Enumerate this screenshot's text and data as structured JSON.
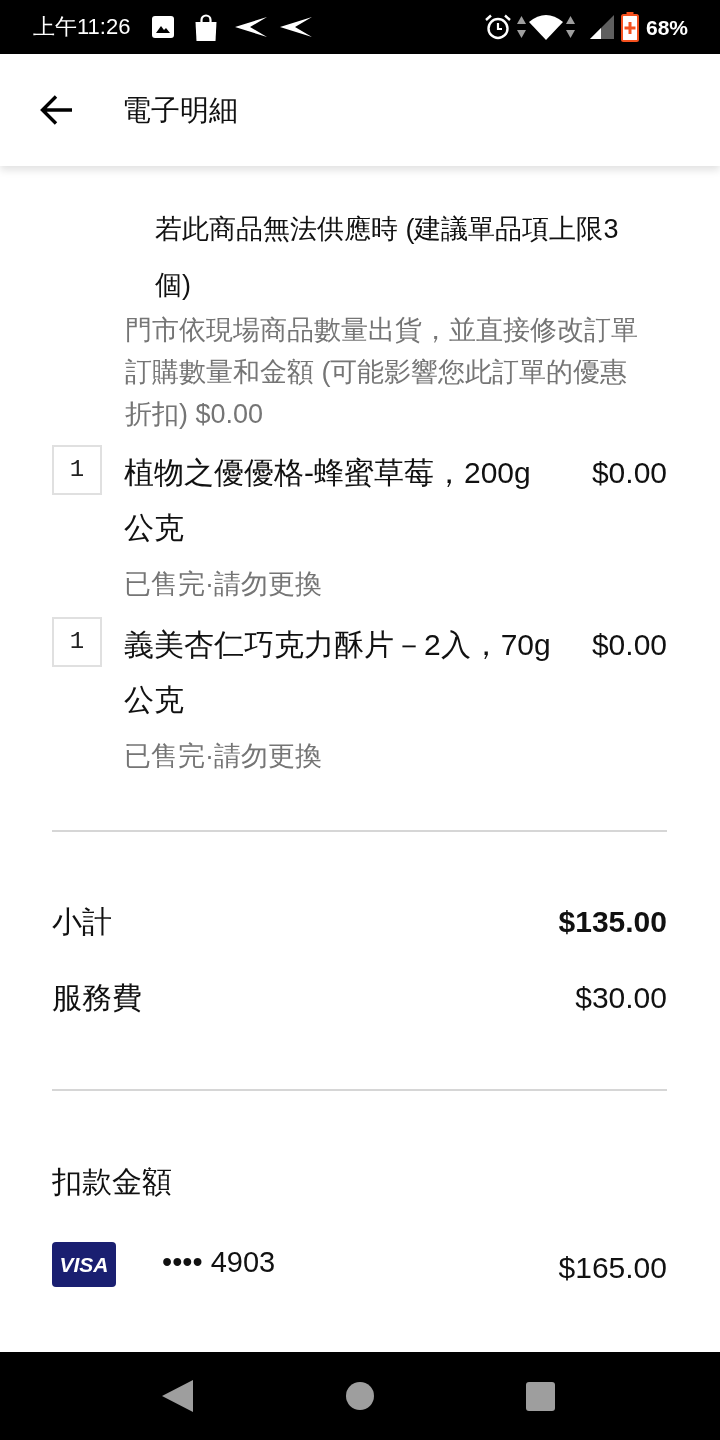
{
  "status_bar": {
    "time": "上午11:26",
    "battery": "68%"
  },
  "header": {
    "title": "電子明細"
  },
  "substitution_note": {
    "title": "若此商品無法供應時 (建議單品項上限3個)",
    "detail": "門市依現場商品數量出貨，並直接修改訂單訂購數量和金額 (可能影響您此訂單的優惠折扣) $0.00"
  },
  "items": [
    {
      "quantity": "1",
      "name": "植物之優優格-蜂蜜草莓，200g公克",
      "price": "$0.00",
      "status": "已售完·請勿更換"
    },
    {
      "quantity": "1",
      "name": "義美杏仁巧克力酥片－2入，70g公克",
      "price": "$0.00",
      "status": "已售完·請勿更換"
    }
  ],
  "totals": [
    {
      "label": "小計",
      "amount": "$135.00",
      "emphasis": true
    },
    {
      "label": "服務費",
      "amount": "$30.00",
      "emphasis": false
    }
  ],
  "payment": {
    "title": "扣款金額",
    "card_brand": "VISA",
    "card_number": "•••• 4903",
    "amount": "$165.00"
  }
}
